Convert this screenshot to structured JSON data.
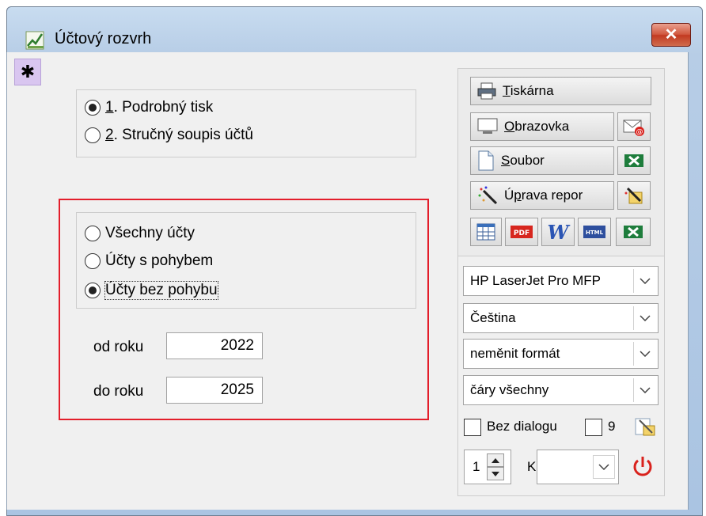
{
  "window": {
    "title": "Účtový rozvrh",
    "close_glyph": "✕"
  },
  "print_mode": {
    "options": [
      {
        "key": "1",
        "label": ". Podrobný tisk",
        "selected": true
      },
      {
        "key": "2",
        "label": ". Stručný soupis účtů",
        "selected": false
      }
    ]
  },
  "account_filter": {
    "options": [
      {
        "label": "Všechny účty",
        "selected": false
      },
      {
        "label": "Účty s  pohybem",
        "selected": false
      },
      {
        "label": "Účty bez pohybu",
        "selected": true
      }
    ],
    "from_label": "od roku",
    "from_value": "2022",
    "to_label": "do roku",
    "to_value": "2025"
  },
  "output": {
    "printer": {
      "hot": "T",
      "rest": "iskárna"
    },
    "screen": {
      "hot": "O",
      "rest": "brazovka"
    },
    "file": {
      "hot": "S",
      "rest": "oubor"
    },
    "edit": {
      "pre": "Ú",
      "hot": "p",
      "rest": "rava repor"
    },
    "icons": [
      "table-icon",
      "pdf-icon",
      "word-icon",
      "html-icon",
      "excel-icon"
    ],
    "pdf_text": "PDF",
    "word_text": "W",
    "html_text": "HTML"
  },
  "settings": {
    "printer_value": "HP LaserJet Pro MFP",
    "language_value": "Čeština",
    "format_value": "neměnit formát",
    "lines_value": "čáry všechny",
    "no_dialog_label": "Bez dialogu",
    "count_label": "9",
    "copies_value": "1",
    "k_label": "K"
  },
  "colors": {
    "accent_red": "#e31e2b",
    "excel_green": "#1e7d3c",
    "power_red": "#d9221d"
  }
}
